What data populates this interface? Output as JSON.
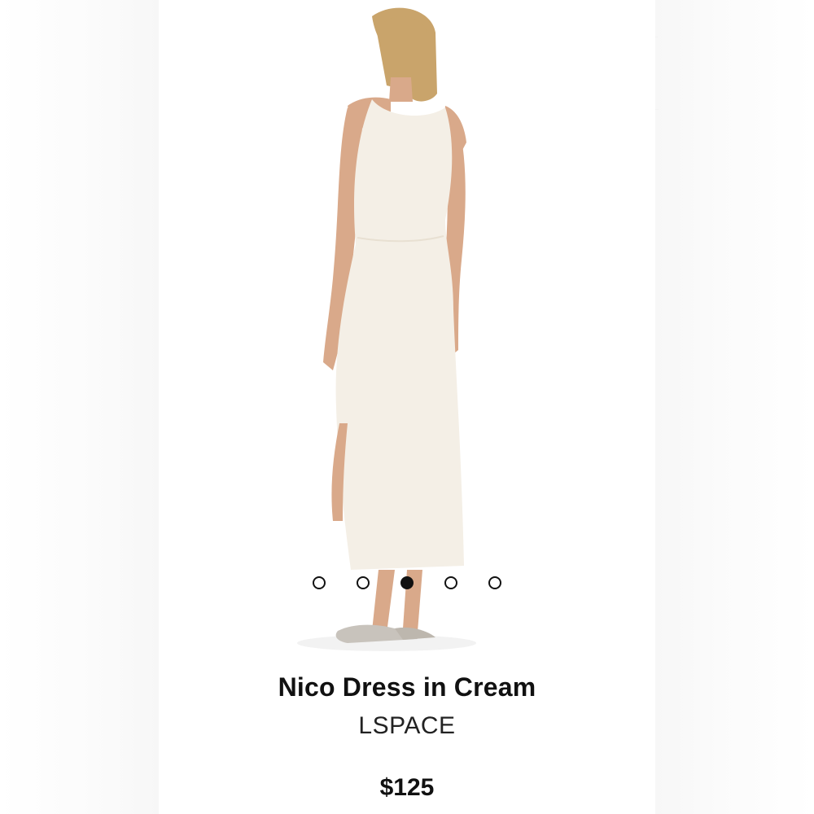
{
  "product": {
    "title": "Nico Dress in Cream",
    "brand": "LSPACE",
    "price": "$125",
    "image_alt": "Model wearing cream sleeveless maxi dress, back view"
  },
  "carousel": {
    "total_slides": 5,
    "active_index": 2
  },
  "colors": {
    "dress": "#f4efe6",
    "skin": "#d9a98a",
    "hair": "#c9a46b",
    "text": "#111111"
  }
}
